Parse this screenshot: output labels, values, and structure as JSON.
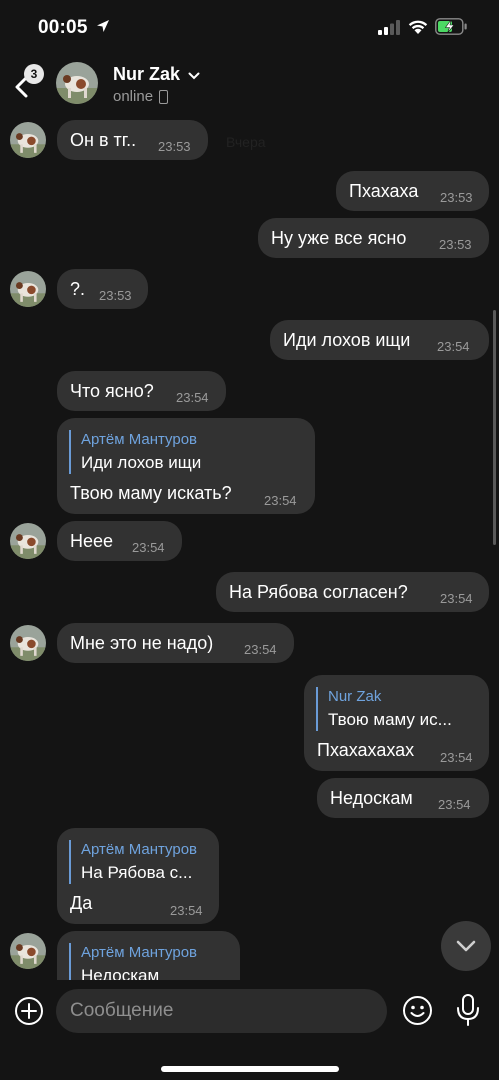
{
  "status_bar": {
    "time": "00:05"
  },
  "header": {
    "back_badge": "3",
    "contact_name": "Nur Zak",
    "contact_status": "online"
  },
  "messages": [
    {
      "side": "in",
      "text": "Он в тг..",
      "time": "23:53",
      "avatar": true
    },
    {
      "side": "out",
      "text": "Пхахаха",
      "time": "23:53"
    },
    {
      "side": "out",
      "text": "Ну уже все ясно",
      "time": "23:53"
    },
    {
      "side": "in",
      "text": "?.",
      "time": "23:53",
      "avatar": true
    },
    {
      "side": "out",
      "text": "Иди лохов ищи",
      "time": "23:54"
    },
    {
      "side": "in",
      "text": "Что ясно?",
      "time": "23:54"
    },
    {
      "side": "in",
      "text": "Твою маму искать?",
      "time": "23:54",
      "reply": {
        "author": "Артём Мантуров",
        "text": "Иди лохов ищи"
      }
    },
    {
      "side": "in",
      "text": "Неее",
      "time": "23:54",
      "avatar": true
    },
    {
      "side": "out",
      "text": "На Рябова согласен?",
      "time": "23:54"
    },
    {
      "side": "in",
      "text": "Мне это не надо)",
      "time": "23:54",
      "avatar": true
    },
    {
      "side": "out",
      "text": "Пхахахахах",
      "time": "23:54",
      "reply": {
        "author": "Nur Zak",
        "text": "Твою маму ис..."
      }
    },
    {
      "side": "out",
      "text": "Недоскам",
      "time": "23:54"
    },
    {
      "side": "in",
      "text": "Да",
      "time": "23:54",
      "reply": {
        "author": "Артём Мантуров",
        "text": "На Рябова с..."
      }
    },
    {
      "side": "in",
      "text": "",
      "time": "",
      "avatar": true,
      "reply": {
        "author": "Артём Мантуров",
        "text": "Недоскам"
      }
    }
  ],
  "input": {
    "placeholder": "Сообщение"
  },
  "colors": {
    "background": "#141414",
    "bubble": "#323232",
    "reply_accent": "#6fa3de",
    "secondary_text": "#9a9a9a"
  },
  "icons": [
    "location-arrow-icon",
    "signal-icon",
    "wifi-icon",
    "battery-charging-icon",
    "back-chevron-icon",
    "chevron-down-icon",
    "phone-device-icon",
    "plus-circle-icon",
    "emoji-icon",
    "microphone-icon",
    "scroll-down-chevron-icon"
  ]
}
